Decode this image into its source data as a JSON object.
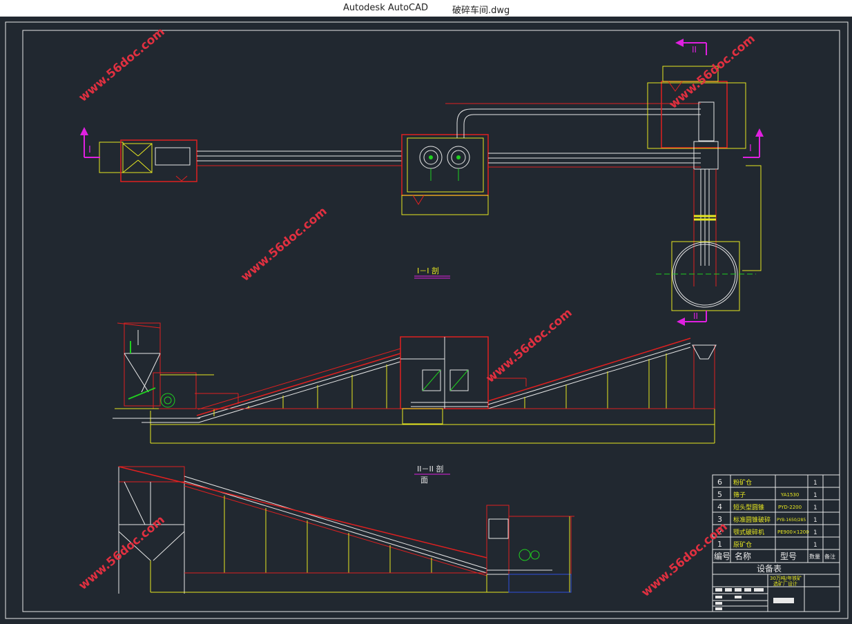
{
  "window": {
    "app_name": "Autodesk AutoCAD",
    "file_name": "破碎车间.dwg"
  },
  "colors": {
    "background": "#212830",
    "frame": "#e8e8e8",
    "red": "#e02020",
    "yellow": "#e8e820",
    "green": "#20d020",
    "cyan": "#30e0e0",
    "magenta": "#e020e0",
    "watermark": "#e03040"
  },
  "drawing": {
    "watermark": "www.56doc.com",
    "section_marks": {
      "one": "I",
      "two": "II"
    },
    "section_titles": {
      "s1": "I－I 剖",
      "s2": "II－II 剖",
      "s2_suffix": "面"
    }
  },
  "equipment_table": {
    "title": "设备表",
    "headers": {
      "no": "编号",
      "name": "名称",
      "model": "型号",
      "qty": "数量",
      "note": "备注"
    },
    "rows": [
      {
        "no": "6",
        "name": "粉矿仓",
        "model": "",
        "qty": "1"
      },
      {
        "no": "5",
        "name": "筛子",
        "model": "YA1530",
        "qty": "1"
      },
      {
        "no": "4",
        "name": "短头型圆锥",
        "model": "PYD-2200",
        "qty": "1"
      },
      {
        "no": "3",
        "name": "标准圆锥破碎",
        "model": "PYB-1650/285",
        "qty": "1"
      },
      {
        "no": "2",
        "name": "颚式破碎机",
        "model": "PE900×1200",
        "qty": "1"
      },
      {
        "no": "1",
        "name": "原矿仓",
        "model": "",
        "qty": "1"
      }
    ]
  },
  "title_block": {
    "project_line1": "30万吨/年铁矿",
    "project_line2": "选矿厂设计"
  }
}
